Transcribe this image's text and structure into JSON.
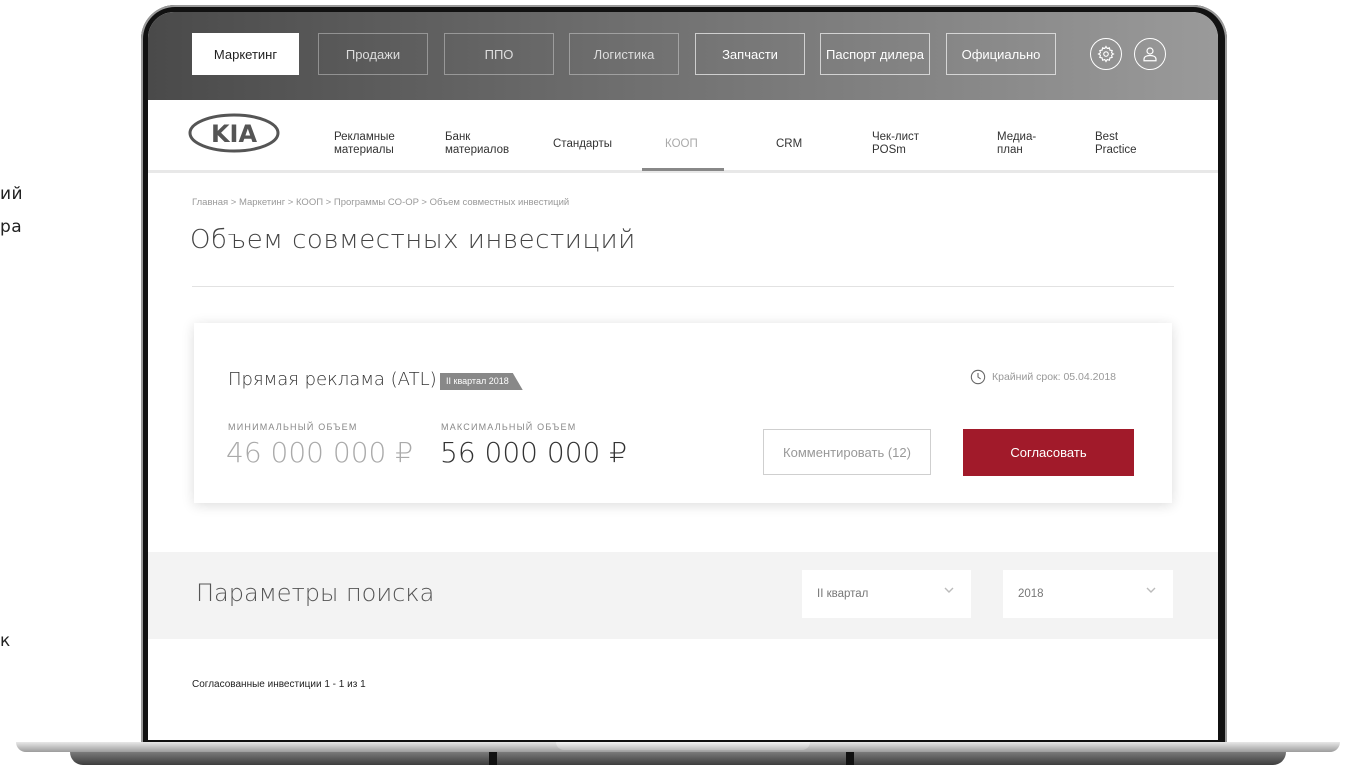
{
  "left_fragments": [
    "ий",
    "ра",
    "к"
  ],
  "top_nav": {
    "tabs": [
      "Маркетинг",
      "Продажи",
      "ППО",
      "Логистика",
      "Запчасти",
      "Паспорт дилера",
      "Официально"
    ],
    "settings_icon": "gear-icon",
    "profile_icon": "user-icon"
  },
  "sub_nav": {
    "logo": "KIA",
    "items": [
      {
        "line1": "Рекламные",
        "line2": "материалы"
      },
      {
        "line1": "Банк",
        "line2": "материалов"
      },
      {
        "line1": "Стандарты",
        "line2": ""
      },
      {
        "line1": "КООП",
        "line2": ""
      },
      {
        "line1": "CRM",
        "line2": ""
      },
      {
        "line1": "Чек-лист",
        "line2": "POSm"
      },
      {
        "line1": "Медиа-",
        "line2": "план"
      },
      {
        "line1": "Best",
        "line2": "Practice"
      }
    ]
  },
  "breadcrumb": "Главная > Маркетинг > КООП > Программы CO-OP > Объем совместных инвестиций",
  "page_title": "Объем совместных инвестиций",
  "card": {
    "title": "Прямая реклама (ATL)",
    "badge": "II квартал 2018",
    "deadline": "Крайний срок: 05.04.2018",
    "min_label": "МИНИМАЛЬНЫЙ ОБЪЕМ",
    "min_value": "46 000 000 ₽",
    "max_label": "МАКСИМАЛЬНЫЙ ОБЪЕМ",
    "max_value": "56 000 000 ₽",
    "comment_button": "Комментировать (12)",
    "approve_button": "Согласовать",
    "accent_color": "#a11a2a"
  },
  "search": {
    "title": "Параметры поиска",
    "quarter_value": "II квартал",
    "year_value": "2018"
  },
  "results_text": "Согласованные инвестиции 1 - 1 из 1"
}
